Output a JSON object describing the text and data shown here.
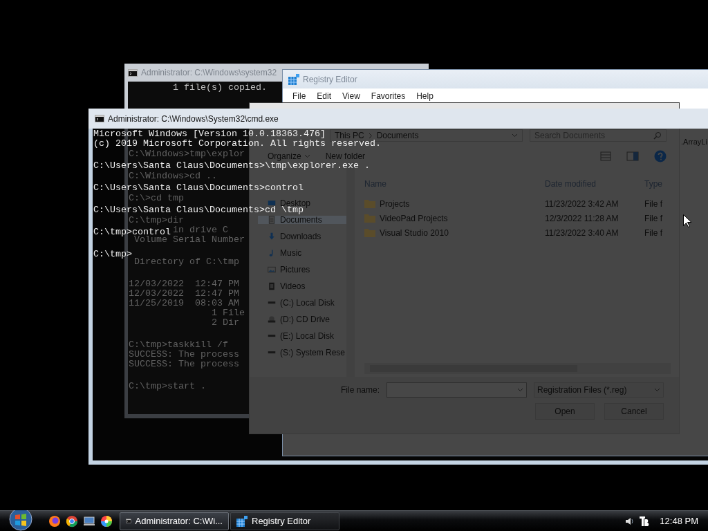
{
  "back_console": {
    "title": "Administrator: C:\\Windows\\system32",
    "visible_lines": [
      "        1 file(s) copied."
    ],
    "shaded_blocks": [
      [
        "C:\\Windows>tmp\\explor"
      ],
      [
        "C:\\Windows>cd .."
      ],
      [
        "C:\\>cd tmp"
      ],
      [
        "C:\\tmp>dir",
        "        in drive C",
        " Volume Serial Number"
      ],
      [
        " Directory of C:\\tmp"
      ],
      [
        "12/03/2022  12:47 PM",
        "12/03/2022  12:47 PM",
        "11/25/2019  08:03 AM",
        "               1 File",
        "               2 Dir"
      ],
      [
        "C:\\tmp>taskkill /f",
        "SUCCESS: The process",
        "SUCCESS: The process"
      ],
      [
        "C:\\tmp>start ."
      ]
    ]
  },
  "registry_editor": {
    "title": "Registry Editor",
    "menu": [
      "File",
      "Edit",
      "View",
      "Favorites",
      "Help"
    ],
    "value_fragment": ".ArrayLi"
  },
  "dialog": {
    "breadcrumb": [
      "This PC",
      "Documents"
    ],
    "search": {
      "placeholder": "Search Documents"
    },
    "toolbar": [
      "Organize",
      "New folder"
    ],
    "nav": [
      {
        "label": "Desktop",
        "kind": "desktop",
        "selected": false
      },
      {
        "label": "Documents",
        "kind": "documents",
        "selected": true
      },
      {
        "label": "Downloads",
        "kind": "downloads",
        "selected": false
      },
      {
        "label": "Music",
        "kind": "music",
        "selected": false
      },
      {
        "label": "Pictures",
        "kind": "pictures",
        "selected": false
      },
      {
        "label": "Videos",
        "kind": "videos",
        "selected": false
      },
      {
        "label": "(C:) Local Disk",
        "kind": "disk",
        "selected": false
      },
      {
        "label": "(D:) CD Drive",
        "kind": "cd",
        "selected": false
      },
      {
        "label": "(E:) Local Disk",
        "kind": "disk",
        "selected": false
      },
      {
        "label": "(S:) System Rese",
        "kind": "disk",
        "selected": false
      }
    ],
    "columns": [
      "Name",
      "Date modified",
      "Type"
    ],
    "files": [
      {
        "name": "Projects",
        "date": "11/23/2022 3:42 AM",
        "type": "File f"
      },
      {
        "name": "VideoPad Projects",
        "date": "12/3/2022 11:28 AM",
        "type": "File f"
      },
      {
        "name": "Visual Studio 2010",
        "date": "11/23/2022 3:40 AM",
        "type": "File f"
      }
    ],
    "file_name_label": "File name:",
    "filter": "Registration Files (*.reg)",
    "buttons": [
      "Open",
      "Cancel"
    ]
  },
  "console": {
    "title": "Administrator: C:\\Windows\\System32\\cmd.exe",
    "blocks": [
      [
        "Microsoft Windows [Version 10.0.18363.476]",
        "(c) 2019 Microsoft Corporation. All rights reserved."
      ],
      [
        "C:\\Users\\Santa Claus\\Documents>\\tmp\\explorer.exe ."
      ],
      [
        "C:\\Users\\Santa Claus\\Documents>control"
      ],
      [
        "C:\\Users\\Santa Claus\\Documents>cd \\tmp"
      ],
      [
        "C:\\tmp>control"
      ],
      [
        "C:\\tmp>"
      ]
    ]
  },
  "taskbar": {
    "tasks": [
      {
        "label": "Administrator: C:\\Wi...",
        "kind": "cmd",
        "selected": true
      },
      {
        "label": "Registry Editor",
        "kind": "regedit",
        "selected": false
      }
    ],
    "clock": "12:48 PM"
  }
}
